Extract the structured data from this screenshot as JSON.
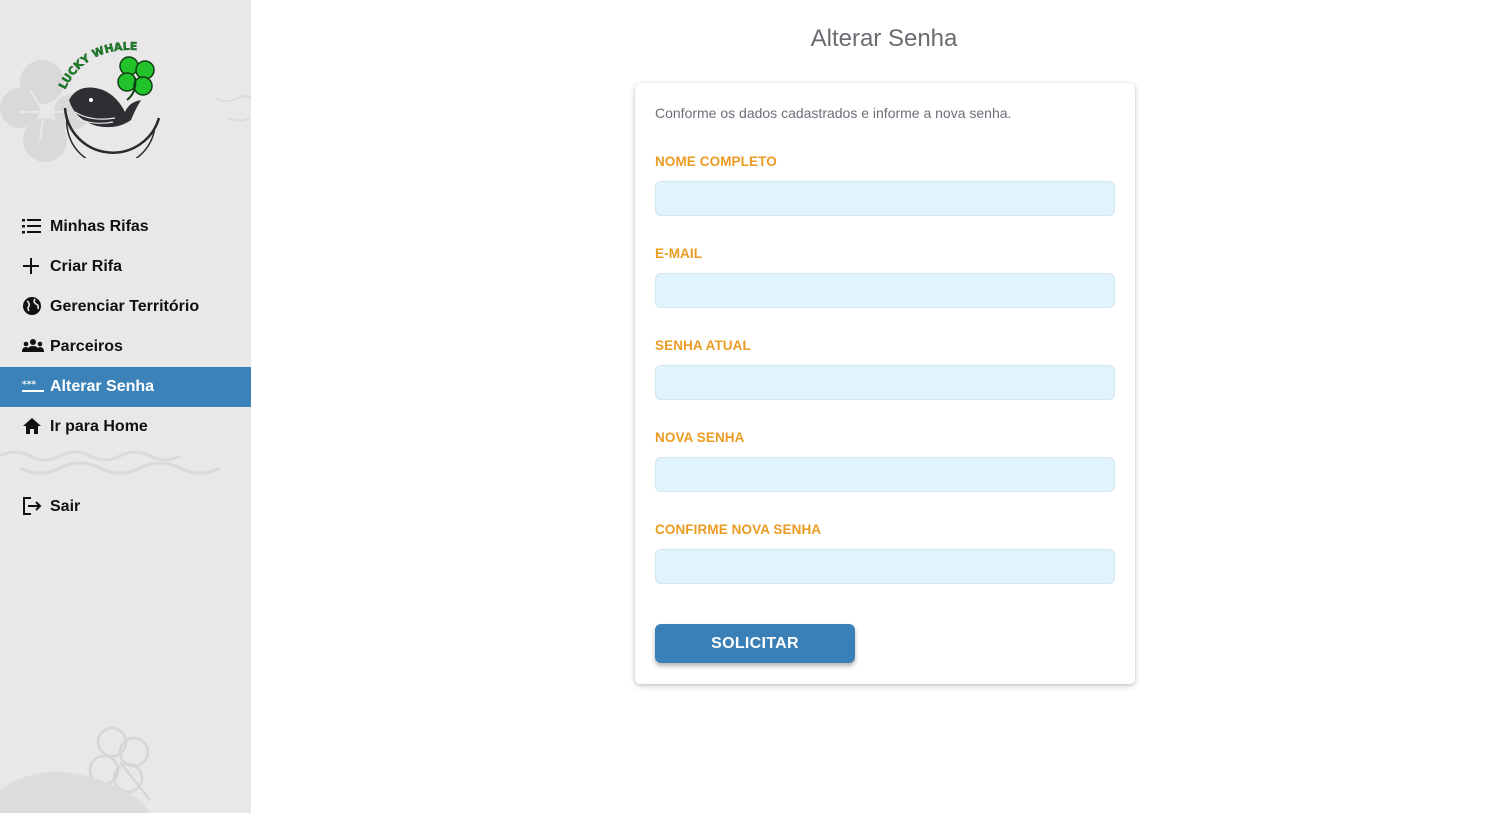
{
  "brand": {
    "logo_text": "LUCKY WHALE"
  },
  "sidebar": {
    "items": [
      {
        "label": "Minhas Rifas",
        "icon": "list-icon"
      },
      {
        "label": "Criar Rifa",
        "icon": "plus-icon"
      },
      {
        "label": "Gerenciar Território",
        "icon": "globe-icon"
      },
      {
        "label": "Parceiros",
        "icon": "people-icon"
      },
      {
        "label": "Alterar Senha",
        "icon": "password-icon",
        "active": true
      },
      {
        "label": "Ir para Home",
        "icon": "home-icon"
      }
    ],
    "logout": {
      "label": "Sair",
      "icon": "logout-icon"
    }
  },
  "main": {
    "title": "Alterar Senha",
    "form": {
      "intro": "Conforme os dados cadastrados e informe a nova senha.",
      "fields": [
        {
          "label": "NOME COMPLETO",
          "value": ""
        },
        {
          "label": "E-MAIL",
          "value": ""
        },
        {
          "label": "SENHA ATUAL",
          "value": ""
        },
        {
          "label": "NOVA SENHA",
          "value": ""
        },
        {
          "label": "CONFIRME NOVA SENHA",
          "value": ""
        }
      ],
      "submit_label": "SOLICITAR"
    }
  },
  "colors": {
    "sidebar_bg": "#e8e8e8",
    "active_bg": "#3a82b8",
    "label_orange": "#eb9b22",
    "input_bg": "#e1f3fc",
    "button_blue": "#3a7fb6"
  }
}
